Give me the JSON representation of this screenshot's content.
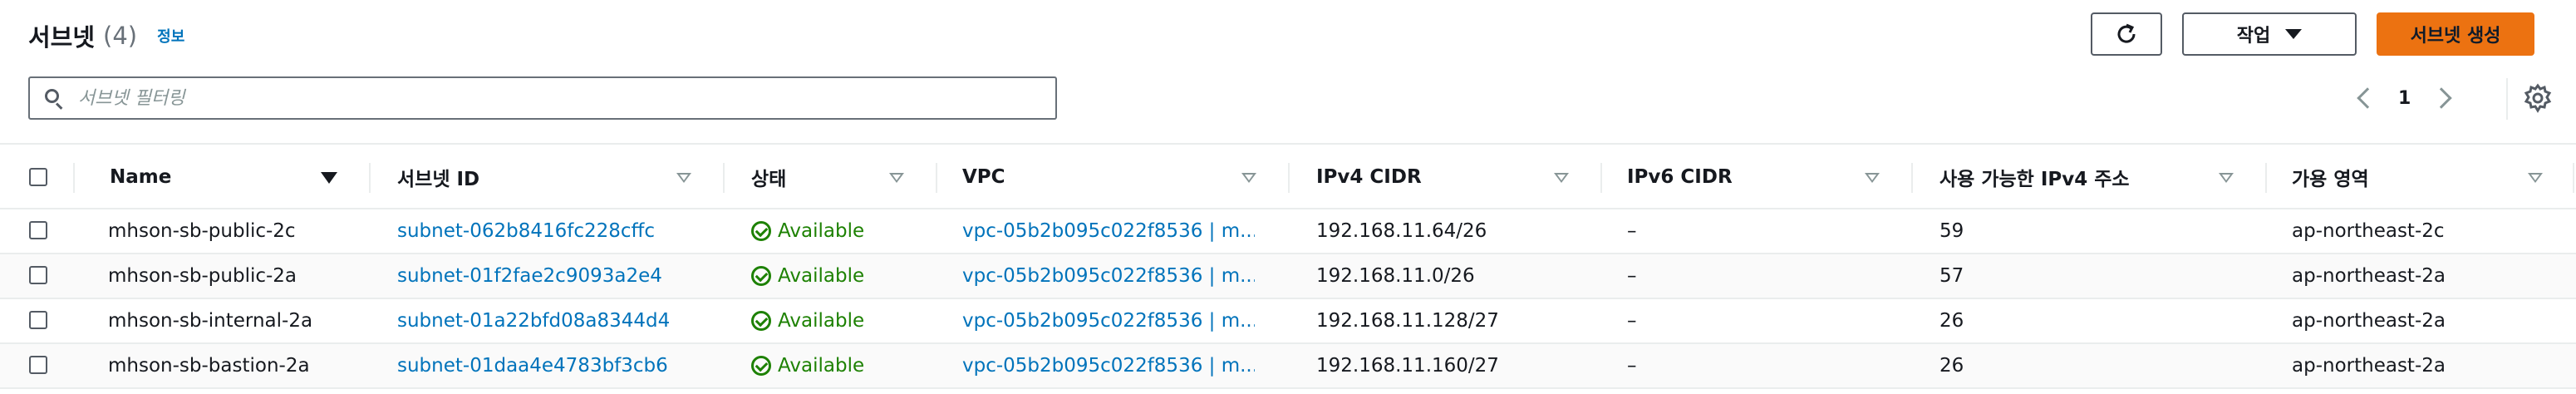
{
  "header": {
    "title": "서브넷",
    "count": "(4)",
    "info_link": "정보"
  },
  "toolbar": {
    "actions_label": "작업",
    "create_label": "서브넷 생성"
  },
  "search": {
    "placeholder": "서브넷 필터링",
    "value": ""
  },
  "pagination": {
    "current_page": "1"
  },
  "table": {
    "columns": [
      {
        "label": "Name"
      },
      {
        "label": "서브넷 ID"
      },
      {
        "label": "상태"
      },
      {
        "label": "VPC"
      },
      {
        "label": "IPv4 CIDR"
      },
      {
        "label": "IPv6 CIDR"
      },
      {
        "label": "사용 가능한 IPv4 주소"
      },
      {
        "label": "가용 영역"
      }
    ],
    "rows": [
      {
        "name": "mhson-sb-public-2c",
        "subnet_id": "subnet-062b8416fc228cffc",
        "status": "Available",
        "vpc": "vpc-05b2b095c022f8536 | m...",
        "ipv4_cidr": "192.168.11.64/26",
        "ipv6_cidr": "–",
        "available_ipv4": "59",
        "az": "ap-northeast-2c"
      },
      {
        "name": "mhson-sb-public-2a",
        "subnet_id": "subnet-01f2fae2c9093a2e4",
        "status": "Available",
        "vpc": "vpc-05b2b095c022f8536 | m...",
        "ipv4_cidr": "192.168.11.0/26",
        "ipv6_cidr": "–",
        "available_ipv4": "57",
        "az": "ap-northeast-2a"
      },
      {
        "name": "mhson-sb-internal-2a",
        "subnet_id": "subnet-01a22bfd08a8344d4",
        "status": "Available",
        "vpc": "vpc-05b2b095c022f8536 | m...",
        "ipv4_cidr": "192.168.11.128/27",
        "ipv6_cidr": "–",
        "available_ipv4": "26",
        "az": "ap-northeast-2a"
      },
      {
        "name": "mhson-sb-bastion-2a",
        "subnet_id": "subnet-01daa4e4783bf3cb6",
        "status": "Available",
        "vpc": "vpc-05b2b095c022f8536 | m...",
        "ipv4_cidr": "192.168.11.160/27",
        "ipv6_cidr": "–",
        "available_ipv4": "26",
        "az": "ap-northeast-2a"
      }
    ]
  },
  "colors": {
    "link": "#0073bb",
    "success": "#1d8102",
    "primary_button": "#ec7211",
    "border": "#eaeded"
  }
}
